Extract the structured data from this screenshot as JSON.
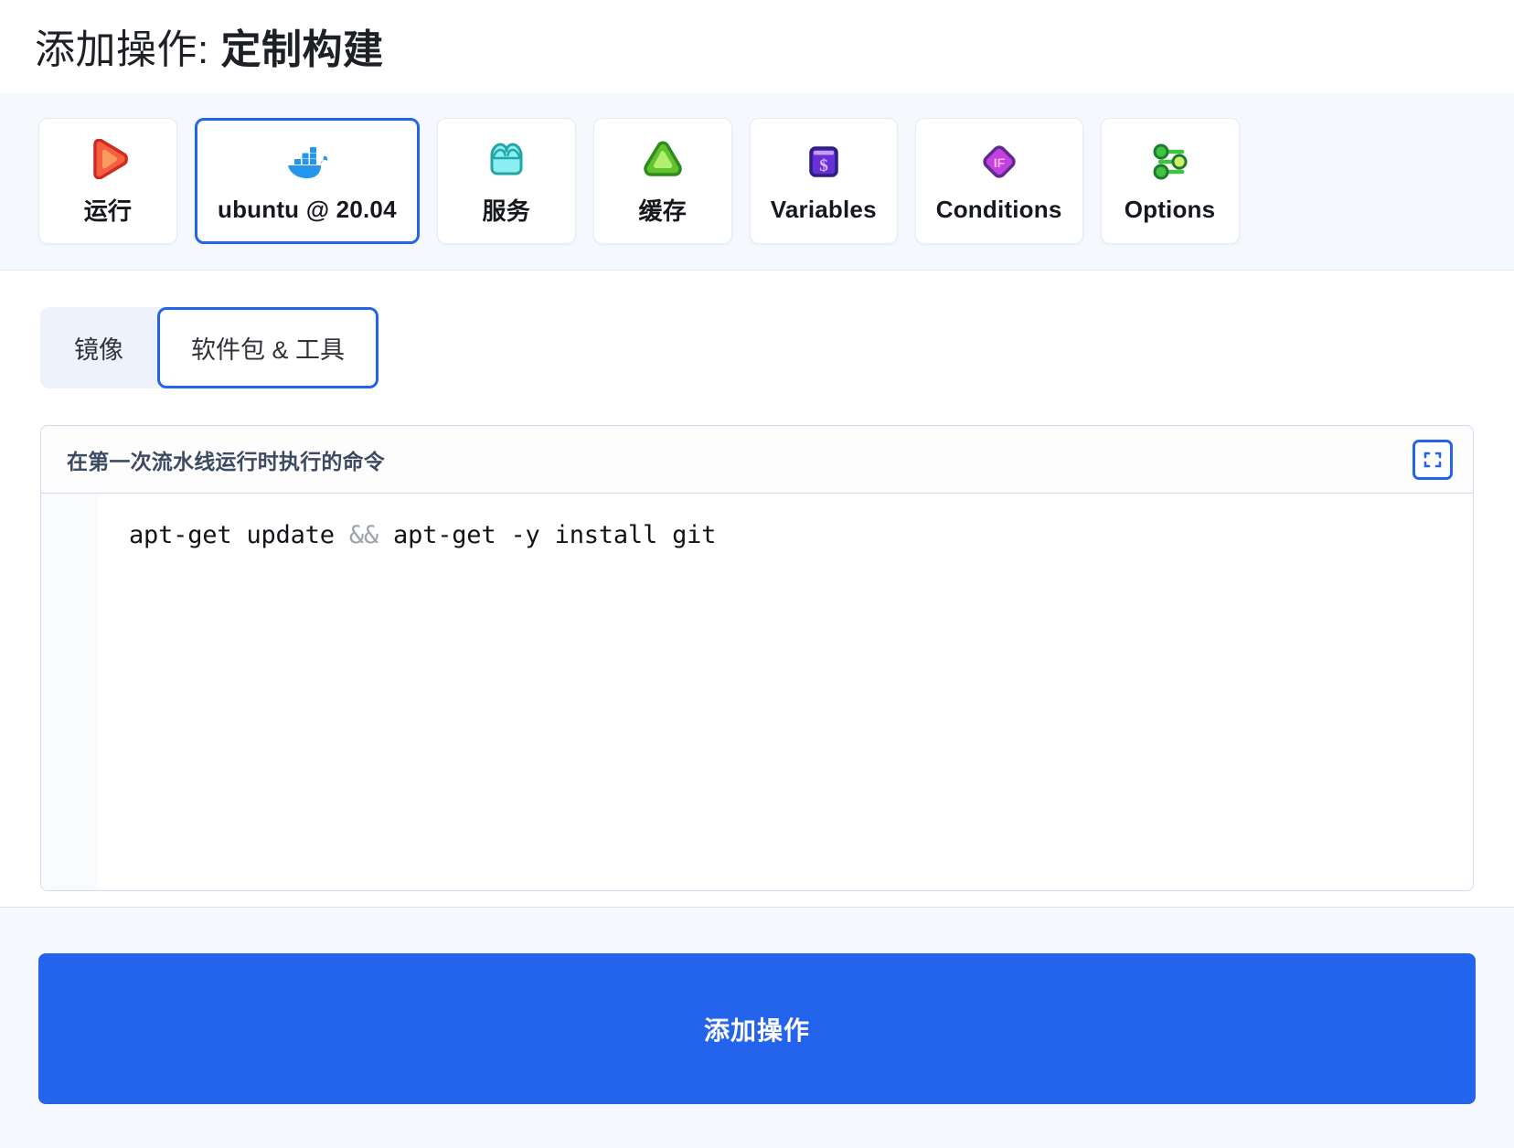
{
  "header": {
    "title_prefix": "添加操作: ",
    "title_strong": "定制构建"
  },
  "type_cards": [
    {
      "label": "运行",
      "icon": "play-icon",
      "selected": false,
      "color": "#f05a3c"
    },
    {
      "label": "ubuntu @ 20.04",
      "icon": "docker-whale-icon",
      "selected": true,
      "color": "#2496ed"
    },
    {
      "label": "服务",
      "icon": "services-icon",
      "selected": false,
      "color": "#49d3d6"
    },
    {
      "label": "缓存",
      "icon": "cache-icon",
      "selected": false,
      "color": "#57c233"
    },
    {
      "label": "Variables",
      "icon": "variables-dollar-icon",
      "selected": false,
      "color": "#7b3fe4"
    },
    {
      "label": "Conditions",
      "icon": "conditions-if-icon",
      "selected": false,
      "color": "#cc44dd"
    },
    {
      "label": "Options",
      "icon": "options-sliders-icon",
      "selected": false,
      "color": "#2eb82e"
    }
  ],
  "tabs": [
    {
      "label": "镜像",
      "active": false
    },
    {
      "label": "软件包 & 工具",
      "active": true
    }
  ],
  "editor": {
    "title": "在第一次流水线运行时执行的命令",
    "expand_icon": "fullscreen-icon",
    "code_part1": "apt-get update ",
    "code_operator": "&&",
    "code_part2": " apt-get -y install git"
  },
  "footer": {
    "submit_label": "添加操作",
    "accent": "#2463eb"
  }
}
